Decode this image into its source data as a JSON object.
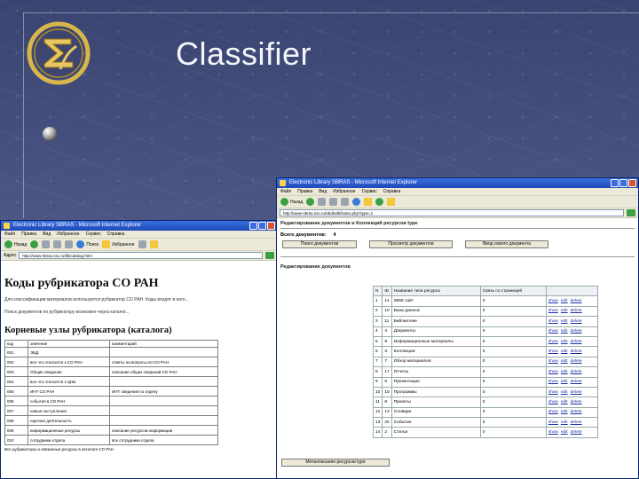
{
  "slide": {
    "title": "Classifier"
  },
  "colors": {
    "slide_bg": "#4b5685",
    "title_text": "#f4f5fb",
    "ie_titlebar": "#1f49b8",
    "link": "#1a2ea8"
  },
  "win_left": {
    "title": "Electronic Library SBRAS - Microsoft Internet Explorer",
    "menu": [
      "Файл",
      "Правка",
      "Вид",
      "Избранное",
      "Сервис",
      "Справка"
    ],
    "toolbar": {
      "back": "Назад",
      "search": "Поиск",
      "favorites": "Избранное"
    },
    "address_label": "Адрес",
    "address": "http://www-sbras.nsc.ru/lib/catalog.html",
    "heading": "Коды рубрикатора СО РАН",
    "para1": "Для классификации материалов используется рубрикатор СО РАН. Коды входят в него...",
    "para2": "Поиск документов по рубрикатору возможен через каталог...",
    "subheading": "Корневые узлы рубрикатора (каталога)",
    "table_headers": [
      "код",
      "значение",
      "комментарий"
    ],
    "table_rows": [
      [
        "001",
        "ЭБД",
        ""
      ],
      [
        "002",
        "все что относится к СО РАН",
        "ответы на вопросы по СО РАН"
      ],
      [
        "003",
        "Общие сведения",
        "описание общих сведений СО РАН"
      ],
      [
        "004",
        "все что относится к ЦНБ",
        ""
      ],
      [
        "005",
        "ИНТ СО РАН",
        "ИНТ сведения по отделу"
      ],
      [
        "006",
        "события в СО РАН",
        ""
      ],
      [
        "007",
        "новые поступления",
        ""
      ],
      [
        "008",
        "научная деятельность",
        ""
      ],
      [
        "009",
        "информационные ресурсы",
        "описание ресурсов информации"
      ],
      [
        "010",
        "сотрудники отдела",
        "все сотрудники отдела"
      ]
    ],
    "footer": "Все рубрикаторы и связанные ресурсы в каталоге СО РАН"
  },
  "win_right": {
    "title": "Electronic Library SBRAS - Microsoft Internet Explorer",
    "menu": [
      "Файл",
      "Правка",
      "Вид",
      "Избранное",
      "Сервис",
      "Справка"
    ],
    "toolbar": {
      "back": "Назад"
    },
    "address": "http://www-sbras.nsc.ru/ebd/edit/index.php?type=1",
    "section1_title": "Редактирование документов и Коллекций ресурсов type",
    "count_label": "Всего документов:",
    "count_value": "4",
    "buttons": [
      "Поиск документов",
      "Просмотр документов",
      "Ввод нового документа"
    ],
    "section2_title": "Редактирование документов",
    "table_headers": [
      "N",
      "ID",
      "Название типа ресурса",
      "Связь со страницей",
      ""
    ],
    "link_labels": [
      "show",
      "edit",
      "delete"
    ],
    "table_rows": [
      [
        "1",
        "14",
        "WEB сайт",
        "0"
      ],
      [
        "2",
        "10",
        "Базы данных",
        "0"
      ],
      [
        "3",
        "11",
        "Библиотеки",
        "0"
      ],
      [
        "4",
        "4",
        "Документы",
        "0"
      ],
      [
        "5",
        "9",
        "Информационные материалы",
        "0"
      ],
      [
        "6",
        "3",
        "Коллекции",
        "0"
      ],
      [
        "7",
        "7",
        "Обзор материалов",
        "0"
      ],
      [
        "8",
        "17",
        "Отчеты",
        "0"
      ],
      [
        "9",
        "6",
        "Презентации",
        "0"
      ],
      [
        "10",
        "15",
        "Программы",
        "0"
      ],
      [
        "11",
        "8",
        "Проекты",
        "0"
      ],
      [
        "12",
        "13",
        "Словари",
        "0"
      ],
      [
        "13",
        "20",
        "События",
        "0"
      ],
      [
        "14",
        "2",
        "Статьи",
        "0"
      ]
    ],
    "add_button": "Метаописание ресурсов type"
  }
}
